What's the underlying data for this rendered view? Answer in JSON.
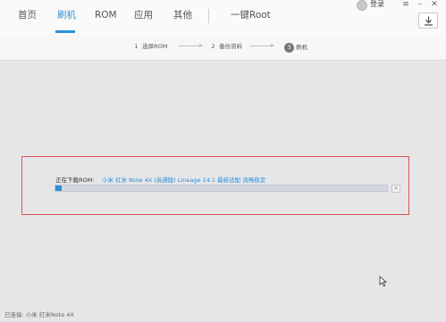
{
  "nav": {
    "tabs": [
      {
        "label": "首页",
        "active": false
      },
      {
        "label": "刷机",
        "active": true
      },
      {
        "label": "ROM",
        "active": false
      },
      {
        "label": "应用",
        "active": false
      },
      {
        "label": "其他",
        "active": false
      }
    ],
    "root_label": "一键Root",
    "login_label": "登录",
    "window_controls": {
      "menu": "≡",
      "minimize": "–",
      "close": "✕"
    },
    "accent_color": "#2c8fd6"
  },
  "steps": [
    {
      "num": "1",
      "label": "选择ROM",
      "current": false
    },
    {
      "num": "2",
      "label": "备份资料",
      "current": false
    },
    {
      "num": "3",
      "label": "刷机",
      "current": true
    }
  ],
  "download": {
    "label": "正在下载ROM:",
    "rom_name": "小米 红米 Note 4X (高通版) Lineage 14.1 最新适配 流畅稳定",
    "progress": 0.02,
    "cancel_symbol": "×"
  },
  "status": {
    "text": "已连接: 小米 红米Note 4X"
  },
  "colors": {
    "highlight_frame": "#d9534f",
    "background": "#e6e6e9"
  }
}
